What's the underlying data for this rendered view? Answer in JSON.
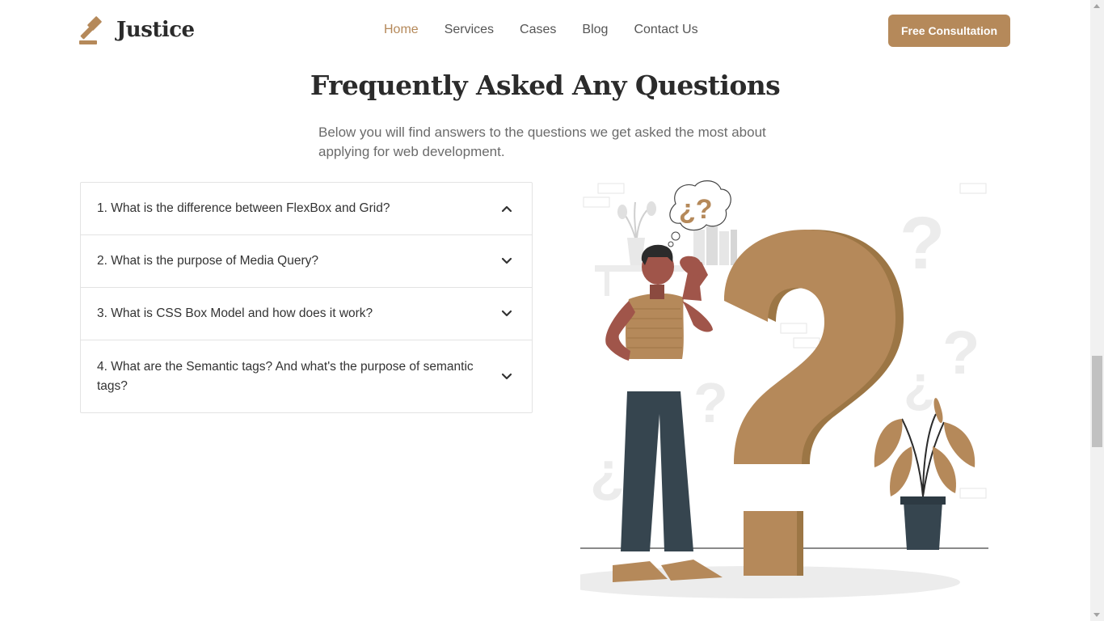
{
  "brand": {
    "name": "Justice",
    "accent_color": "#b5895a"
  },
  "nav": {
    "items": [
      {
        "label": "Home",
        "active": true
      },
      {
        "label": "Services",
        "active": false
      },
      {
        "label": "Cases",
        "active": false
      },
      {
        "label": "Blog",
        "active": false
      },
      {
        "label": "Contact Us",
        "active": false
      }
    ],
    "cta_label": "Free Consultation"
  },
  "faq": {
    "title": "Frequently Asked Any Questions",
    "subtitle": "Below you will find answers to the questions we get asked the most about applying for web development.",
    "items": [
      {
        "question": "1. What is the difference between FlexBox and Grid?",
        "expanded": true
      },
      {
        "question": "2. What is the purpose of Media Query?",
        "expanded": false
      },
      {
        "question": "3. What is CSS Box Model and how does it work?",
        "expanded": false
      },
      {
        "question": "4. What are the Semantic tags? And what's the purpose of semantic tags?",
        "expanded": false
      }
    ]
  },
  "illustration": {
    "icon": "question-mark-person-illustration"
  }
}
